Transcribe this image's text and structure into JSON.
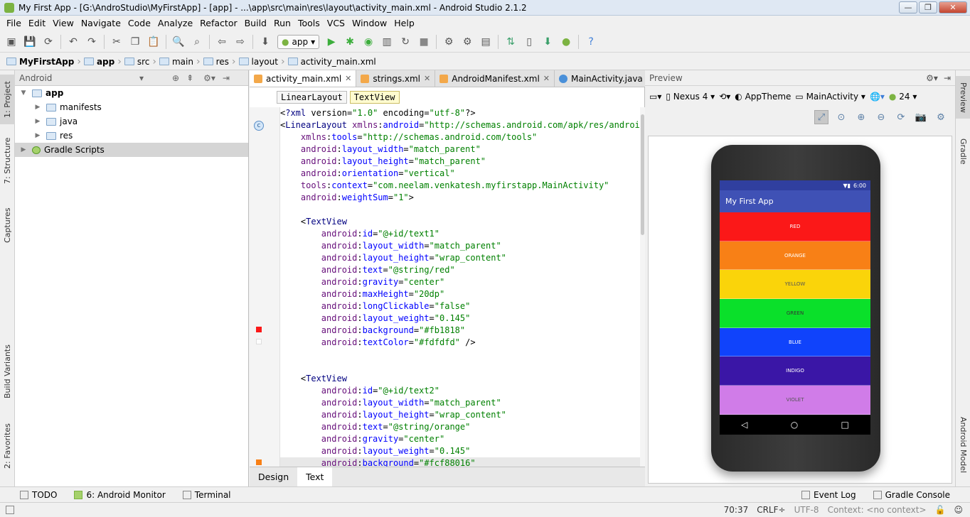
{
  "window": {
    "title": "My First App - [G:\\AndroStudio\\MyFirstApp] - [app] - ...\\app\\src\\main\\res\\layout\\activity_main.xml - Android Studio 2.1.2",
    "btn_min": "—",
    "btn_max": "❐",
    "btn_close": "✕"
  },
  "menu": [
    "File",
    "Edit",
    "View",
    "Navigate",
    "Code",
    "Analyze",
    "Refactor",
    "Build",
    "Run",
    "Tools",
    "VCS",
    "Window",
    "Help"
  ],
  "toolbar": {
    "run_config": "app"
  },
  "breadcrumb": [
    "MyFirstApp",
    "app",
    "src",
    "main",
    "res",
    "layout",
    "activity_main.xml"
  ],
  "left_tabs": [
    "1: Project",
    "7: Structure",
    "Captures",
    "Build Variants",
    "2: Favorites"
  ],
  "right_tabs": [
    "Preview",
    "Gradle",
    "Android Model"
  ],
  "project": {
    "view_label": "Android",
    "tree": [
      {
        "label": "app",
        "level": 0,
        "bold": true
      },
      {
        "label": "manifests",
        "level": 1
      },
      {
        "label": "java",
        "level": 1
      },
      {
        "label": "res",
        "level": 1
      },
      {
        "label": "Gradle Scripts",
        "level": 0
      }
    ]
  },
  "editor": {
    "tabs": [
      "activity_main.xml",
      "strings.xml",
      "AndroidManifest.xml",
      "MainActivity.java"
    ],
    "crumbs": [
      "LinearLayout",
      "TextView"
    ],
    "bottom_tabs": [
      "Design",
      "Text"
    ],
    "lines": [
      "<?xml version=\"1.0\" encoding=\"utf-8\"?>",
      "<LinearLayout xmlns:android=\"http://schemas.android.com/apk/res/android\"",
      "    xmlns:tools=\"http://schemas.android.com/tools\"",
      "    android:layout_width=\"match_parent\"",
      "    android:layout_height=\"match_parent\"",
      "    android:orientation=\"vertical\"",
      "    tools:context=\"com.neelam.venkatesh.myfirstapp.MainActivity\"",
      "    android:weightSum=\"1\">",
      "",
      "    <TextView",
      "        android:id=\"@+id/text1\"",
      "        android:layout_width=\"match_parent\"",
      "        android:layout_height=\"wrap_content\"",
      "        android:text=\"@string/red\"",
      "        android:gravity=\"center\"",
      "        android:maxHeight=\"20dp\"",
      "        android:longClickable=\"false\"",
      "        android:layout_weight=\"0.145\"",
      "        android:background=\"#fb1818\"",
      "        android:textColor=\"#fdfdfd\" />",
      "",
      "",
      "    <TextView",
      "        android:id=\"@+id/text2\"",
      "        android:layout_width=\"match_parent\"",
      "        android:layout_height=\"wrap_content\"",
      "        android:text=\"@string/orange\"",
      "        android:gravity=\"center\"",
      "        android:layout_weight=\"0.145\"",
      "        android:background=\"#fcf88016\""
    ]
  },
  "preview": {
    "header": "Preview",
    "device": "Nexus 4",
    "theme": "AppTheme",
    "activity": "MainActivity",
    "api": "24",
    "clock": "6:00",
    "app_title": "My First App",
    "bands": [
      {
        "label": "RED",
        "color": "#fb1818",
        "text": "#fdfdfd"
      },
      {
        "label": "ORANGE",
        "color": "#f88016",
        "text": "#ffffff"
      },
      {
        "label": "YELLOW",
        "color": "#fad40a",
        "text": "#555555"
      },
      {
        "label": "GREEN",
        "color": "#0ae02a",
        "text": "#333333"
      },
      {
        "label": "BLUE",
        "color": "#1043fb",
        "text": "#ffffff"
      },
      {
        "label": "INDIGO",
        "color": "#3a16a6",
        "text": "#ffffff"
      },
      {
        "label": "VIOLET",
        "color": "#d07ce8",
        "text": "#555555"
      }
    ],
    "nav_keys": [
      "◁",
      "○",
      "□"
    ]
  },
  "bottom_windows": {
    "left": [
      "TODO",
      "6: Android Monitor",
      "Terminal"
    ],
    "right": [
      "Event Log",
      "Gradle Console"
    ]
  },
  "status": {
    "position": "70:37",
    "line_sep": "CRLF÷",
    "encoding": "UTF-8",
    "context": "Context: <no context>"
  }
}
